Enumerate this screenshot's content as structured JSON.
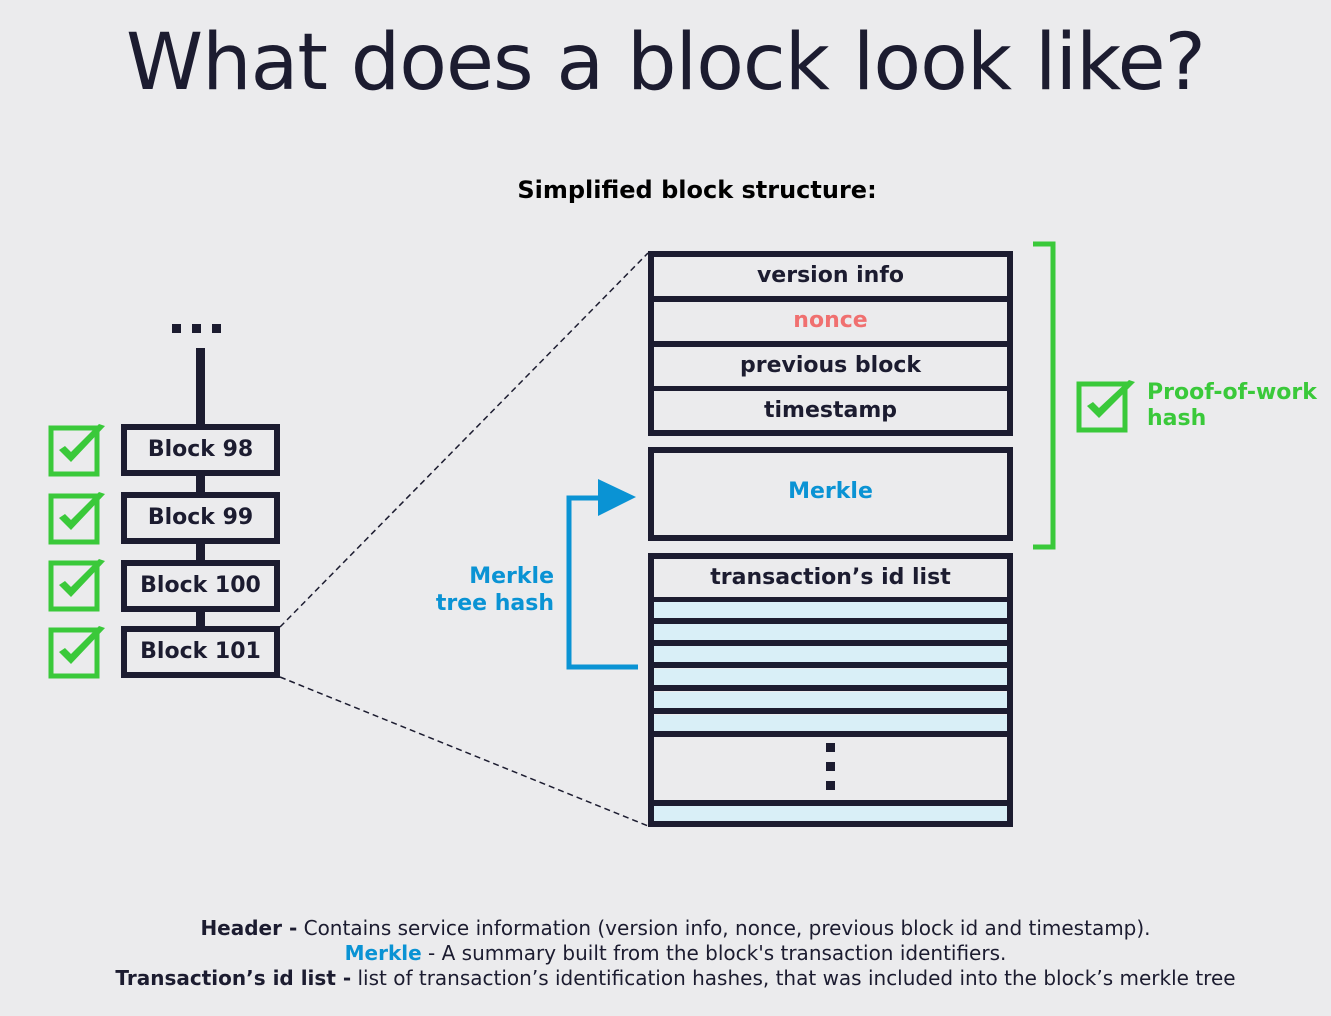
{
  "title": "What does a block look like?",
  "subtitle": "Simplified block structure:",
  "colors": {
    "dark": "#1c1c30",
    "green": "#3ac93a",
    "blue": "#0a93d4",
    "nonce": "#f07070",
    "tx_fill": "#d9eff7",
    "background": "#ebebed"
  },
  "chain": {
    "ellipsis": "...",
    "blocks": [
      {
        "label": "Block 98",
        "verified": true
      },
      {
        "label": "Block 99",
        "verified": true
      },
      {
        "label": "Block 100",
        "verified": true
      },
      {
        "label": "Block 101",
        "verified": true
      }
    ]
  },
  "block_structure": {
    "header_fields": [
      "version info",
      "nonce",
      "previous block",
      "timestamp"
    ],
    "merkle_label": "Merkle",
    "tx_list_label": "transaction’s id list",
    "tx_rows_visible": 7
  },
  "annotations": {
    "pow_line1": "Proof-of-work",
    "pow_line2": "hash",
    "merkle_tree_line1": "Merkle",
    "merkle_tree_line2": "tree hash"
  },
  "footer": {
    "lines": [
      {
        "term": "Header -",
        "desc": " Contains service information (version info, nonce, previous block id and timestamp)."
      },
      {
        "term": "Merkle",
        "desc": " - A summary built from the block's transaction identifiers."
      },
      {
        "term": "Transaction’s id list -",
        "desc": " list of transaction’s identification hashes, that was included into the block’s merkle tree"
      }
    ]
  }
}
